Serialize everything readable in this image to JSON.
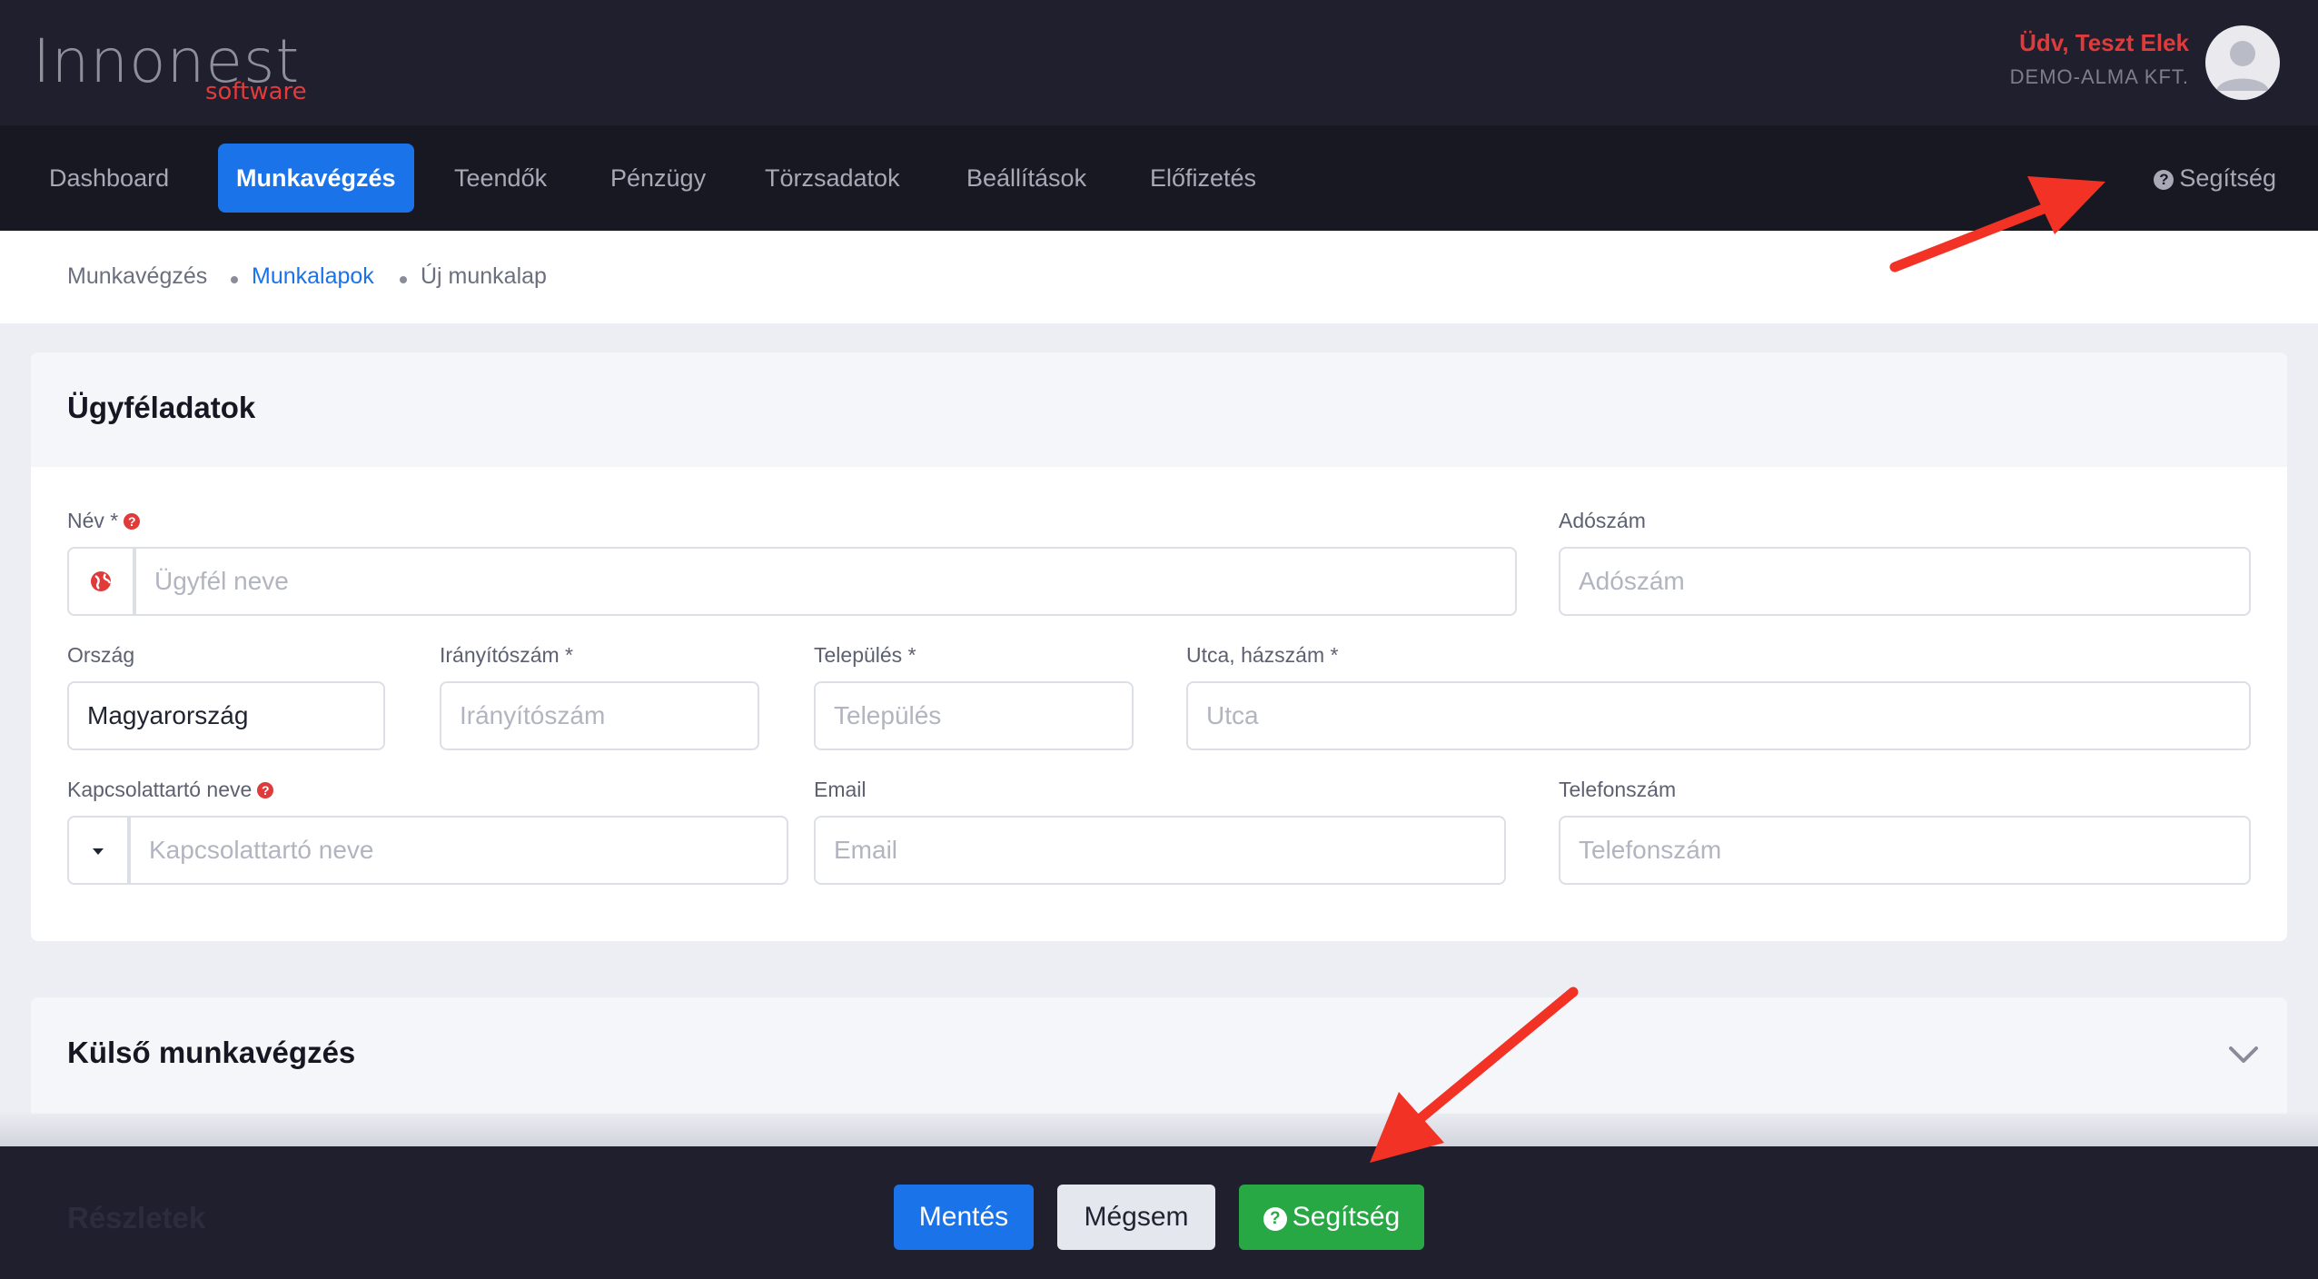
{
  "header": {
    "logo_main": "Innonest",
    "logo_sub": "software",
    "greeting": "Üdv, Teszt Elek",
    "company": "DEMO-ALMA KFT."
  },
  "nav": {
    "items": [
      {
        "label": "Dashboard"
      },
      {
        "label": "Munkavégzés"
      },
      {
        "label": "Teendők"
      },
      {
        "label": "Pénzügy"
      },
      {
        "label": "Törzsadatok"
      },
      {
        "label": "Beállítások"
      },
      {
        "label": "Előfizetés"
      }
    ],
    "active": "Munkavégzés",
    "help": "Segítség"
  },
  "breadcrumb": {
    "items": [
      "Munkavégzés",
      "Munkalapok",
      "Új munkalap"
    ]
  },
  "customer_card": {
    "title": "Ügyféladatok",
    "fields": {
      "name": {
        "label": "Név *",
        "placeholder": "Ügyfél neve"
      },
      "tax": {
        "label": "Adószám",
        "placeholder": "Adószám"
      },
      "country": {
        "label": "Ország",
        "value": "Magyarország"
      },
      "zip": {
        "label": "Irányítószám *",
        "placeholder": "Irányítószám"
      },
      "city": {
        "label": "Település *",
        "placeholder": "Település"
      },
      "street": {
        "label": "Utca, házszám *",
        "placeholder": "Utca"
      },
      "contact": {
        "label": "Kapcsolattartó neve",
        "placeholder": "Kapcsolattartó neve"
      },
      "email": {
        "label": "Email",
        "placeholder": "Email"
      },
      "phone": {
        "label": "Telefonszám",
        "placeholder": "Telefonszám"
      }
    }
  },
  "external_card": {
    "title": "Külső munkavégzés"
  },
  "details_card": {
    "title": "Részletek"
  },
  "footer": {
    "save": "Mentés",
    "cancel": "Mégsem",
    "help": "Segítség"
  },
  "colors": {
    "accent": "#1a73e8",
    "success": "#28a745",
    "danger": "#e13a3a",
    "annotation_arrow": "#f23224"
  }
}
